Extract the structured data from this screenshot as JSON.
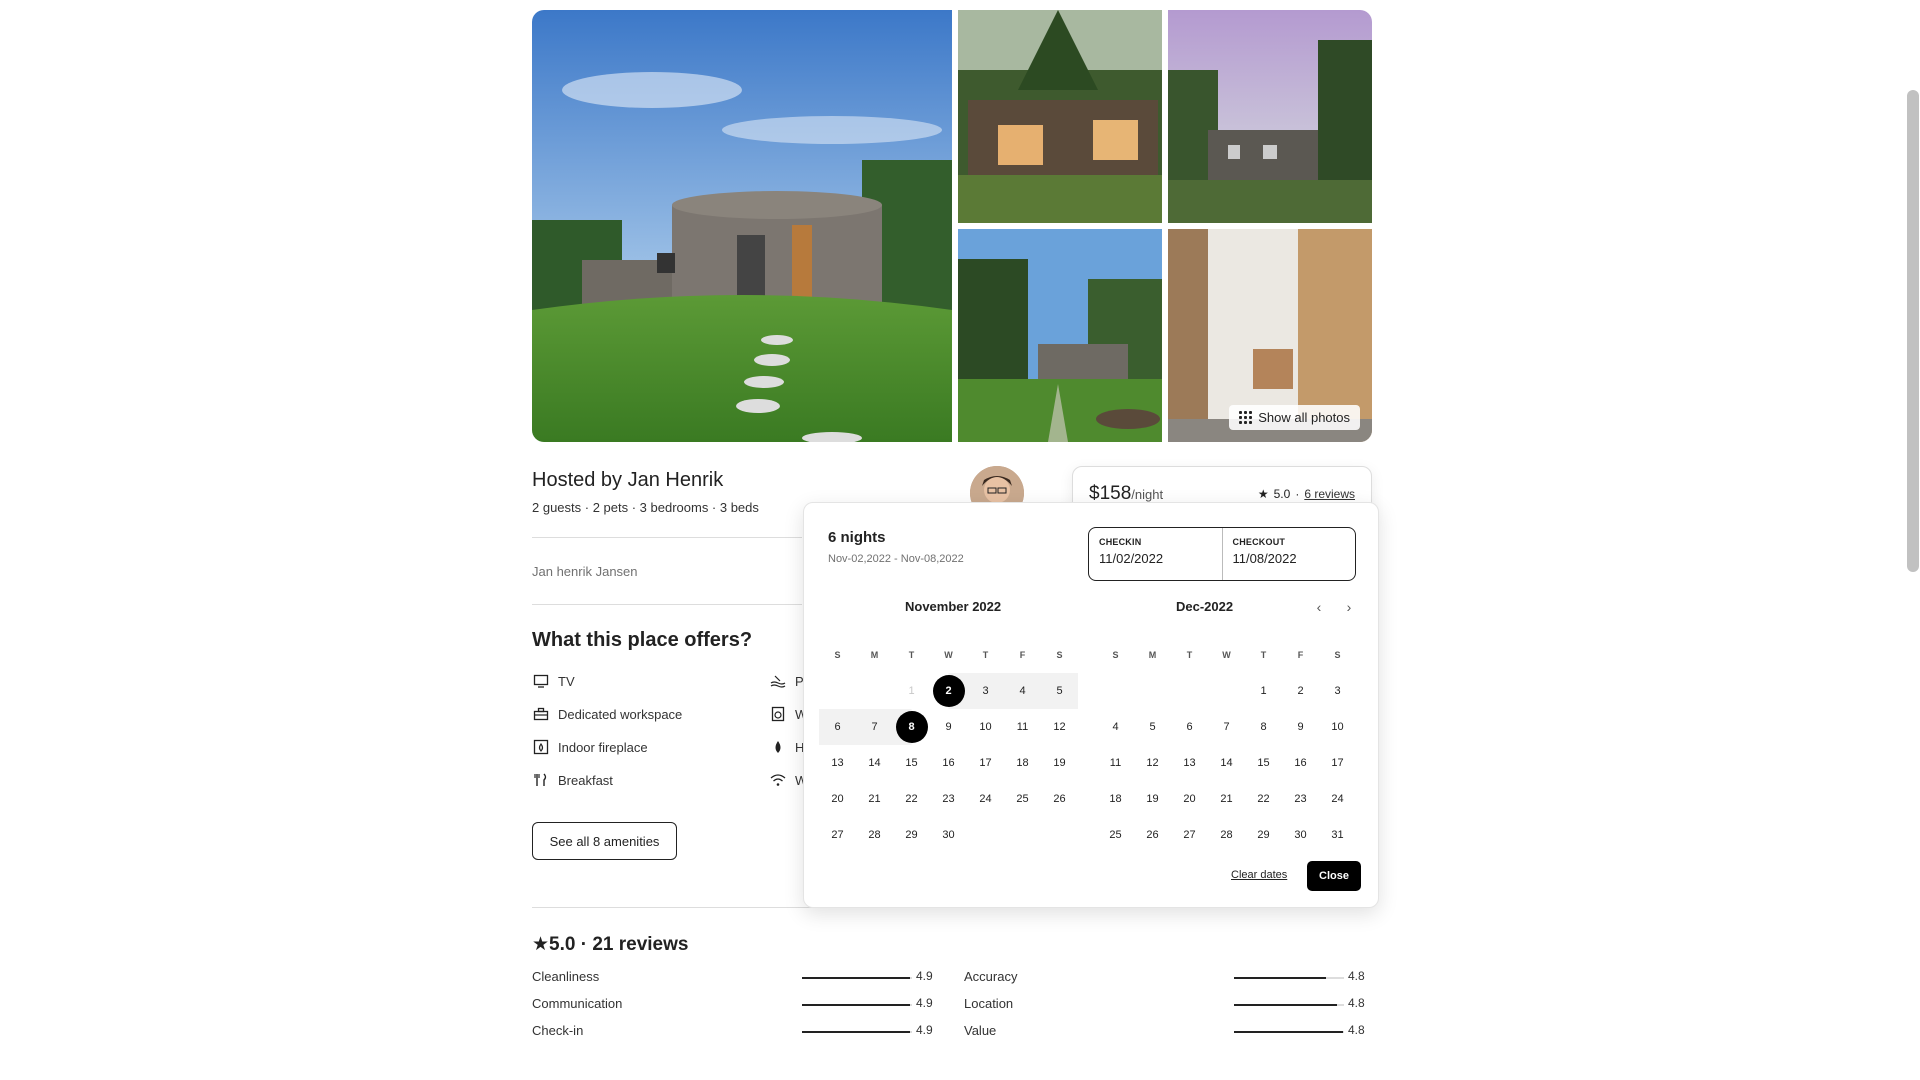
{
  "gallery": {
    "show_all_label": "Show all photos"
  },
  "host": {
    "title": "Hosted by Jan Henrik",
    "subtitle": "2 guests · 2 pets · 3 bedrooms · 3 beds",
    "name": "Jan henrik Jansen"
  },
  "offers": {
    "title": "What this place offers?",
    "amenities": [
      {
        "label": "TV",
        "icon": "tv-icon"
      },
      {
        "label": "Dedicated workspace",
        "icon": "workspace-icon"
      },
      {
        "label": "Indoor fireplace",
        "icon": "fireplace-icon"
      },
      {
        "label": "Breakfast",
        "icon": "breakfast-icon"
      },
      {
        "label": "Pc",
        "icon": "pool-icon"
      },
      {
        "label": "W",
        "icon": "washer-icon"
      },
      {
        "label": "H",
        "icon": "hair-dryer-icon"
      },
      {
        "label": "W",
        "icon": "wifi-icon"
      }
    ],
    "see_all_label": "See all 8 amenities"
  },
  "booking": {
    "price": "$158",
    "per_night": "/night",
    "rating": "5.0",
    "separator": "·",
    "reviews_link": "6 reviews"
  },
  "calendar": {
    "nights_title": "6 nights",
    "range": "Nov-02,2022 - Nov-08,2022",
    "checkin_label": "CHECKIN",
    "checkin_value": "11/02/2022",
    "checkout_label": "CHECKOUT",
    "checkout_value": "11/08/2022",
    "weekdays": [
      "S",
      "M",
      "T",
      "W",
      "T",
      "F",
      "S"
    ],
    "months": [
      {
        "title": "November 2022",
        "lead_blank": 2,
        "days": 30,
        "muted": [
          1
        ],
        "selected": [
          2,
          8
        ],
        "in_range": [
          3,
          4,
          5,
          6,
          7
        ]
      },
      {
        "title": "Dec-2022",
        "lead_blank": 4,
        "days": 31,
        "muted": [],
        "selected": [],
        "in_range": []
      }
    ],
    "prev_icon": "chevron-left-icon",
    "next_icon": "chevron-right-icon",
    "clear_label": "Clear dates",
    "close_label": "Close"
  },
  "reviews": {
    "title": "★5.0 · 21 reviews",
    "metrics": [
      {
        "label": "Cleanliness",
        "value": "4.9",
        "fraction": 0.98
      },
      {
        "label": "Communication",
        "value": "4.9",
        "fraction": 0.98
      },
      {
        "label": "Check-in",
        "value": "4.9",
        "fraction": 0.98
      },
      {
        "label": "Accuracy",
        "value": "4.8",
        "fraction": 0.84
      },
      {
        "label": "Location",
        "value": "4.8",
        "fraction": 0.94
      },
      {
        "label": "Value",
        "value": "4.8",
        "fraction": 0.99
      }
    ]
  }
}
